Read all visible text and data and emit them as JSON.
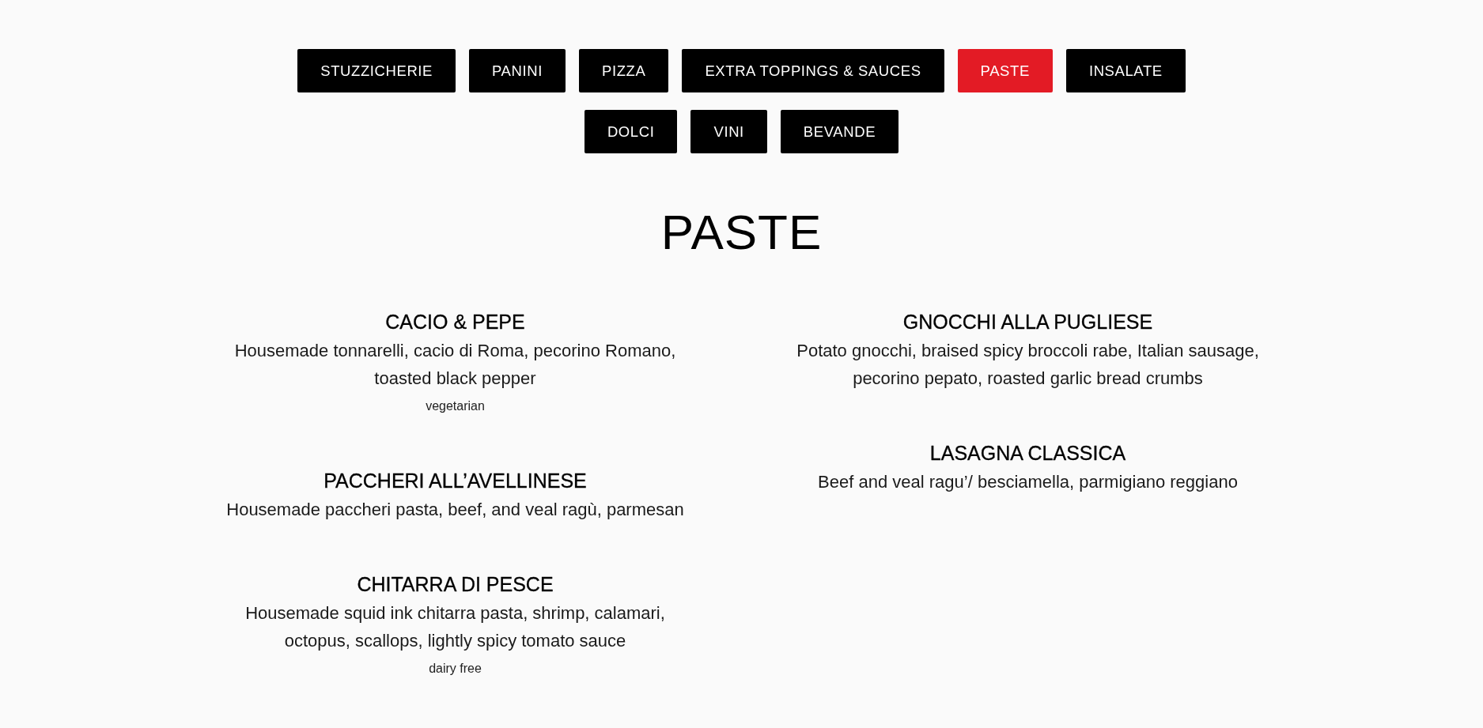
{
  "nav": {
    "tabs": [
      {
        "label": "STUZZICHERIE",
        "selected": false
      },
      {
        "label": "PANINI",
        "selected": false
      },
      {
        "label": "PIZZA",
        "selected": false
      },
      {
        "label": "EXTRA TOPPINGS & SAUCES",
        "selected": false
      },
      {
        "label": "PASTE",
        "selected": true
      },
      {
        "label": "INSALATE",
        "selected": false
      },
      {
        "label": "DOLCI",
        "selected": false
      },
      {
        "label": "VINI",
        "selected": false
      },
      {
        "label": "BEVANDE",
        "selected": false
      }
    ]
  },
  "section": {
    "title": "PASTE",
    "columns": [
      [
        {
          "name": "CACIO & PEPE",
          "description": "Housemade tonnarelli, cacio di Roma, pecorino Romano, toasted black pepper",
          "tags": [
            "vegetarian"
          ]
        },
        {
          "name": "PACCHERI ALL’AVELLINESE",
          "description": "Housemade paccheri pasta, beef, and veal ragù, parmesan"
        },
        {
          "name": "CHITARRA DI PESCE",
          "description": "Housemade squid ink chitarra pasta, shrimp, calamari, octopus, scallops, lightly spicy tomato sauce",
          "tags": [
            "dairy free"
          ]
        }
      ],
      [
        {
          "name": "GNOCCHI ALLA PUGLIESE",
          "description": "Potato gnocchi, braised spicy broccoli rabe, Italian sausage, pecorino pepato, roasted garlic bread crumbs"
        },
        {
          "name": "LASAGNA CLASSICA",
          "description": "Beef and veal ragu’/ besciamella, parmigiano reggiano"
        }
      ]
    ]
  }
}
